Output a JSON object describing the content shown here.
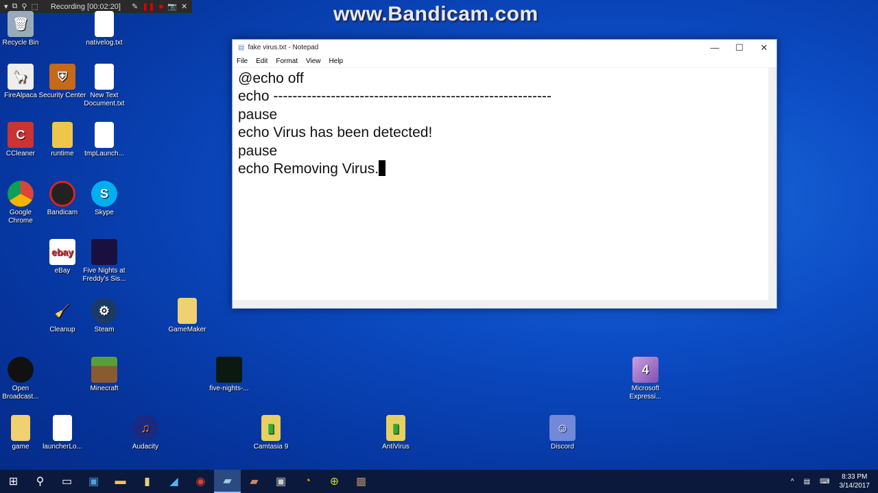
{
  "recorder": {
    "status": "Recording [00:02:20]"
  },
  "watermark": "www.Bandicam.com",
  "desktop_icons": {
    "recycle_bin": "Recycle Bin",
    "nativelog": "nativelog.txt",
    "firealpaca": "FireAlpaca",
    "security_center": "Security Center",
    "new_text": "New Text Document.txt",
    "ccleaner": "CCleaner",
    "runtime": "runtime",
    "tmplaunch": "tmpLaunch...",
    "chrome": "Google Chrome",
    "bandicam": "Bandicam",
    "skype": "Skype",
    "ebay": "eBay",
    "fnaf": "Five Nights at Freddy's Sis...",
    "cleanup": "Cleanup",
    "steam": "Steam",
    "gamemaker": "GameMaker",
    "obs": "Open Broadcast...",
    "minecraft": "Minecraft",
    "five_nights": "five-nights-...",
    "ms_expression": "Microsoft Expressi...",
    "game": "game",
    "launcherlo": "launcherLo...",
    "audacity": "Audacity",
    "camtasia": "Camtasia 9",
    "antivirus": "AntiVirus",
    "discord": "Discord"
  },
  "notepad": {
    "title": "fake virus.txt - Notepad",
    "menu": [
      "File",
      "Edit",
      "Format",
      "View",
      "Help"
    ],
    "lines": [
      "@echo off",
      "echo ----------------------------------------------------------",
      "pause",
      "echo Virus has been detected!",
      "pause",
      "echo Removing Virus."
    ]
  },
  "taskbar": {
    "time": "8:33 PM",
    "date": "3/14/2017"
  }
}
